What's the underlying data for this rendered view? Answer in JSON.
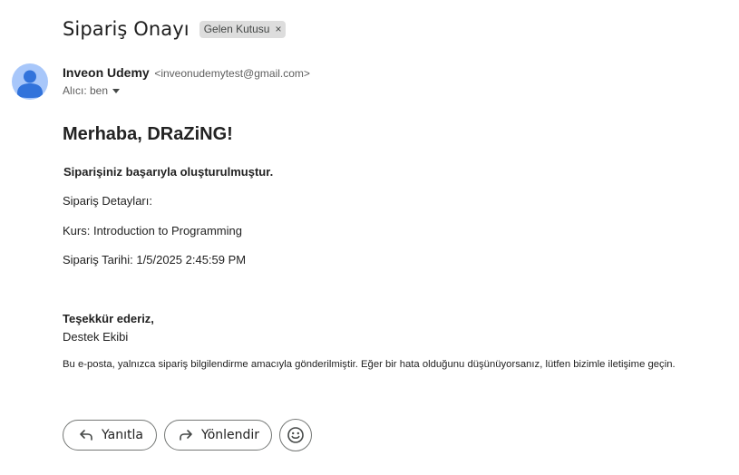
{
  "header": {
    "subject": "Sipariş Onayı",
    "label_chip": "Gelen Kutusu",
    "label_remove": "×"
  },
  "sender": {
    "name": "Inveon Udemy",
    "email": "<inveonudemytest@gmail.com>",
    "recipient": "Alıcı: ben"
  },
  "message": {
    "greeting": "Merhaba, DRaZiNG!",
    "confirmation": "Siparişiniz başarıyla oluşturulmuştur.",
    "details_heading": "Sipariş Detayları:",
    "course": "Kurs: Introduction to Programming",
    "order_date": "Sipariş Tarihi: 1/5/2025 2:45:59 PM",
    "thanks": "Teşekkür ederiz,",
    "signature": "Destek Ekibi",
    "footer_note": "Bu e-posta, yalnızca sipariş bilgilendirme amacıyla gönderilmiştir. Eğer bir hata olduğunu düşünüyorsanız, lütfen bizimle iletişime geçin."
  },
  "actions": {
    "reply_label": "Yanıtla",
    "forward_label": "Yönlendir"
  },
  "icons": {
    "avatar": "person-icon",
    "reply": "reply-icon",
    "forward": "forward-icon",
    "emoji": "emoji-icon",
    "recipient_details": "chevron-down-icon"
  },
  "colors": {
    "avatar_bg": "#a8c7fa",
    "avatar_fg": "#0b57d0",
    "chip_bg": "#dddddd",
    "button_border": "#747775"
  }
}
